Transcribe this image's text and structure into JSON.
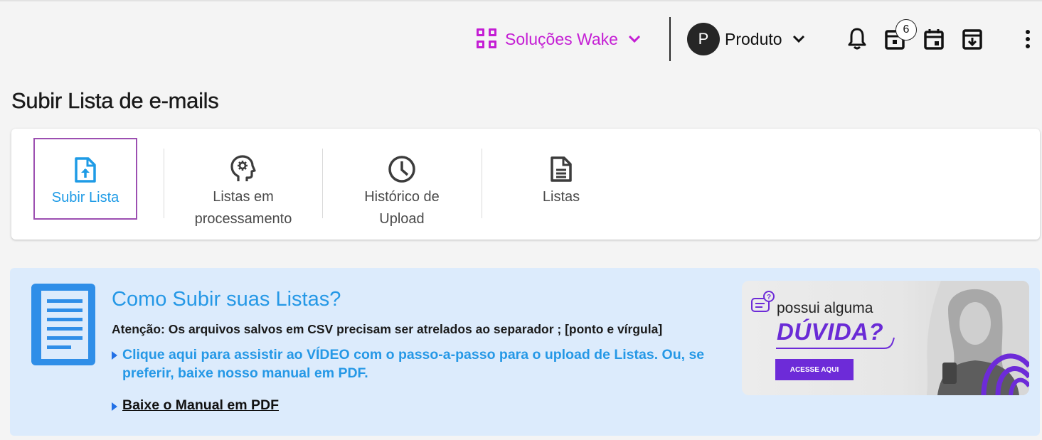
{
  "header": {
    "solutions_label": "Soluções Wake",
    "account_initial": "P",
    "account_label": "Produto",
    "notification_badge": "6"
  },
  "colors": {
    "accent_purple": "#c41ed4",
    "link_blue": "#2598e6",
    "active_tab_border": "#9c4fb1",
    "panel_bg": "#dcebfc"
  },
  "page": {
    "title": "Subir Lista de e-mails"
  },
  "tabs": [
    {
      "label": "Subir Lista",
      "icon": "file-upload-icon",
      "active": true
    },
    {
      "label": "Listas em processamento",
      "icon": "head-gear-icon",
      "active": false
    },
    {
      "label": "Histórico de Upload",
      "icon": "clock-icon",
      "active": false
    },
    {
      "label": "Listas",
      "icon": "document-icon",
      "active": false
    }
  ],
  "help": {
    "title": "Como Subir suas Listas?",
    "warning": "Atenção: Os arquivos salvos em CSV precisam ser atrelados ao separador ; [ponto e vírgula]",
    "video_link": "Clique aqui para assistir ao VÍDEO com o passo-a-passo para o upload de Listas. Ou, se preferir, baixe nosso manual em PDF.",
    "manual_link": "Baixe o Manual em PDF"
  },
  "banner": {
    "line1": "possui alguma",
    "line2": "DÚVIDA?",
    "button": "ACESSE AQUI"
  }
}
